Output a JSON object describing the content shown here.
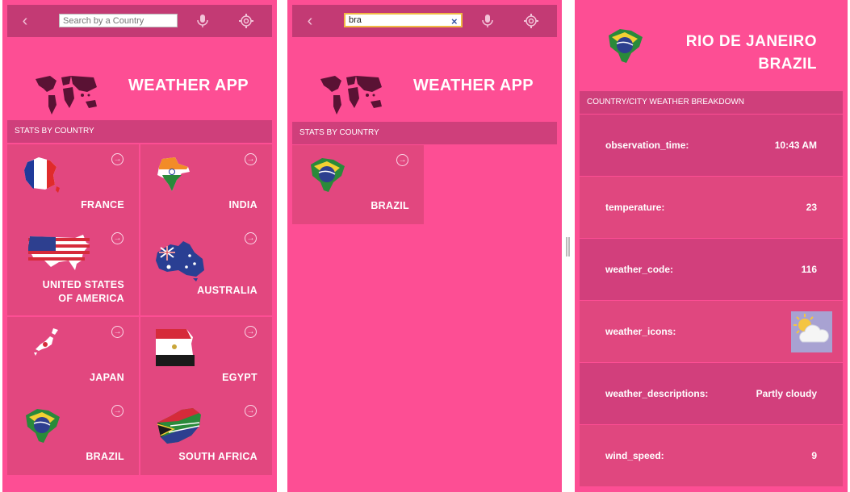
{
  "panel1": {
    "search_placeholder": "Search by a Country",
    "app_title": "WEATHER APP",
    "section_label": "STATS BY COUNTRY",
    "countries": [
      {
        "name_line1": "FRANCE",
        "name_line2": ""
      },
      {
        "name_line1": "INDIA",
        "name_line2": ""
      },
      {
        "name_line1": "UNITED STATES",
        "name_line2": "OF AMERICA"
      },
      {
        "name_line1": "AUSTRALIA",
        "name_line2": ""
      },
      {
        "name_line1": "JAPAN",
        "name_line2": ""
      },
      {
        "name_line1": "EGYPT",
        "name_line2": ""
      },
      {
        "name_line1": "BRAZIL",
        "name_line2": ""
      },
      {
        "name_line1": "SOUTH AFRICA",
        "name_line2": ""
      }
    ]
  },
  "panel2": {
    "search_value": "bra",
    "clear_icon": "×",
    "app_title": "WEATHER APP",
    "section_label": "STATS BY COUNTRY",
    "results": [
      {
        "name": "BRAZIL"
      }
    ]
  },
  "panel3": {
    "city": "RIO DE JANEIRO",
    "country": "BRAZIL",
    "section_label": "COUNTRY/CITY WEATHER BREAKDOWN",
    "rows": [
      {
        "key": "observation_time:",
        "value": "10:43 AM"
      },
      {
        "key": "temperature:",
        "value": "23"
      },
      {
        "key": "weather_code:",
        "value": "116"
      },
      {
        "key": "weather_icons:",
        "value": ""
      },
      {
        "key": "weather_descriptions:",
        "value": "Partly cloudy"
      },
      {
        "key": "wind_speed:",
        "value": "9"
      }
    ]
  },
  "icons": {
    "back": "‹",
    "arrow": "→"
  },
  "colors": {
    "background": "#fd4e94",
    "topbar": "#c33a74",
    "section_bar": "#cf3f7b",
    "card": "#e2477f"
  }
}
